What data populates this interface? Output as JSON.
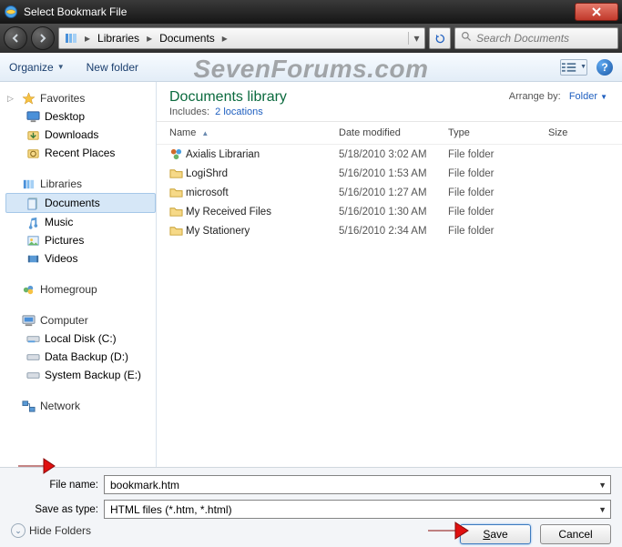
{
  "window": {
    "title": "Select Bookmark File"
  },
  "nav": {
    "breadcrumb": [
      "Libraries",
      "Documents"
    ],
    "search_placeholder": "Search Documents"
  },
  "toolbar": {
    "organize": "Organize",
    "new_folder": "New folder"
  },
  "watermark": "SevenForums.com",
  "sidebar": {
    "favorites": {
      "label": "Favorites",
      "items": [
        {
          "label": "Desktop"
        },
        {
          "label": "Downloads"
        },
        {
          "label": "Recent Places"
        }
      ]
    },
    "libraries": {
      "label": "Libraries",
      "items": [
        {
          "label": "Documents",
          "selected": true
        },
        {
          "label": "Music"
        },
        {
          "label": "Pictures"
        },
        {
          "label": "Videos"
        }
      ]
    },
    "homegroup": {
      "label": "Homegroup"
    },
    "computer": {
      "label": "Computer",
      "items": [
        {
          "label": "Local Disk (C:)"
        },
        {
          "label": "Data Backup (D:)"
        },
        {
          "label": "System Backup (E:)"
        }
      ]
    },
    "network": {
      "label": "Network"
    }
  },
  "library": {
    "title": "Documents library",
    "includes_label": "Includes:",
    "includes_link": "2 locations",
    "arrange_label": "Arrange by:",
    "arrange_value": "Folder"
  },
  "columns": {
    "name": "Name",
    "date": "Date modified",
    "type": "Type",
    "size": "Size"
  },
  "files": [
    {
      "name": "Axialis Librarian",
      "date": "5/18/2010 3:02 AM",
      "type": "File folder",
      "icon": "custom"
    },
    {
      "name": "LogiShrd",
      "date": "5/16/2010 1:53 AM",
      "type": "File folder",
      "icon": "folder"
    },
    {
      "name": "microsoft",
      "date": "5/16/2010 1:27 AM",
      "type": "File folder",
      "icon": "folder"
    },
    {
      "name": "My Received Files",
      "date": "5/16/2010 1:30 AM",
      "type": "File folder",
      "icon": "folder"
    },
    {
      "name": "My Stationery",
      "date": "5/16/2010 2:34 AM",
      "type": "File folder",
      "icon": "folder"
    }
  ],
  "bottom": {
    "filename_label": "File name:",
    "filename_value": "bookmark.htm",
    "saveas_label": "Save as type:",
    "saveas_value": "HTML files (*.htm, *.html)",
    "hide_folders": "Hide Folders",
    "save": "Save",
    "cancel": "Cancel"
  }
}
